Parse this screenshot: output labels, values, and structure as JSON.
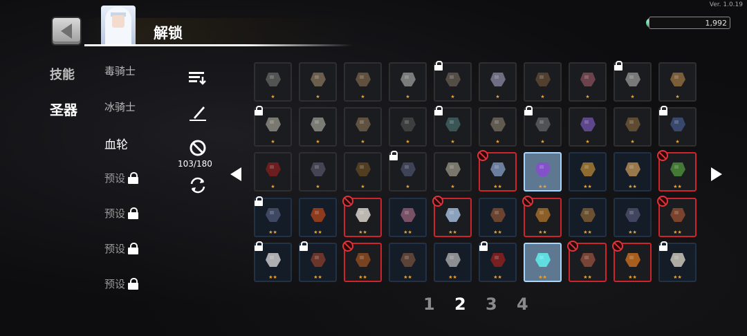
{
  "version": "Ver. 1.0.19",
  "header": {
    "title": "解锁",
    "currency": "1,992"
  },
  "categories": [
    {
      "label": "技能",
      "active": false
    },
    {
      "label": "圣器",
      "active": true
    }
  ],
  "subcategories": [
    {
      "label": "毒骑士",
      "state": "normal",
      "locked": false
    },
    {
      "label": "冰骑士",
      "state": "normal",
      "locked": false
    },
    {
      "label": "血轮",
      "state": "active",
      "locked": false
    },
    {
      "label": "预设",
      "state": "preset",
      "locked": true
    },
    {
      "label": "预设",
      "state": "preset",
      "locked": true
    },
    {
      "label": "预设",
      "state": "preset",
      "locked": true
    },
    {
      "label": "预设",
      "state": "preset",
      "locked": true
    }
  ],
  "tools": {
    "sort_icon": "sort-icon",
    "pen_icon": "pen-icon",
    "forbid_icon": "forbid-icon",
    "refresh_icon": "refresh-icon",
    "forbid_count": "103/180"
  },
  "grid": {
    "rows": [
      [
        {
          "item": "jar",
          "stars": "★",
          "badge": "",
          "style": "normal"
        },
        {
          "item": "claw",
          "stars": "★",
          "badge": "",
          "style": "normal"
        },
        {
          "item": "necklace",
          "stars": "★",
          "badge": "",
          "style": "normal"
        },
        {
          "item": "pearl",
          "stars": "★",
          "badge": "",
          "style": "normal"
        },
        {
          "item": "stone",
          "stars": "★",
          "badge": "lock",
          "style": "normal"
        },
        {
          "item": "feather-blade",
          "stars": "★",
          "badge": "",
          "style": "normal"
        },
        {
          "item": "boot",
          "stars": "★",
          "badge": "",
          "style": "normal"
        },
        {
          "item": "meat",
          "stars": "★",
          "badge": "",
          "style": "normal"
        },
        {
          "item": "spider-leg",
          "stars": "★",
          "badge": "lock",
          "style": "normal"
        },
        {
          "item": "bone-arm",
          "stars": "★",
          "badge": "",
          "style": "normal"
        }
      ],
      [
        {
          "item": "quill",
          "stars": "★",
          "badge": "lock",
          "style": "normal"
        },
        {
          "item": "fan",
          "stars": "★",
          "badge": "",
          "style": "normal"
        },
        {
          "item": "glove",
          "stars": "★",
          "badge": "",
          "style": "normal"
        },
        {
          "item": "pan",
          "stars": "★",
          "badge": "",
          "style": "normal"
        },
        {
          "item": "bowl",
          "stars": "★",
          "badge": "lock",
          "style": "normal"
        },
        {
          "item": "scroll",
          "stars": "★",
          "badge": "",
          "style": "normal"
        },
        {
          "item": "armor",
          "stars": "★",
          "badge": "lock",
          "style": "normal"
        },
        {
          "item": "magnet",
          "stars": "★",
          "badge": "",
          "style": "normal"
        },
        {
          "item": "arrow",
          "stars": "★",
          "badge": "",
          "style": "normal"
        },
        {
          "item": "shield",
          "stars": "★",
          "badge": "lock",
          "style": "normal"
        }
      ],
      [
        {
          "item": "blood-vial",
          "stars": "★",
          "badge": "",
          "style": "normal"
        },
        {
          "item": "serpent",
          "stars": "★",
          "badge": "",
          "style": "normal"
        },
        {
          "item": "pouch",
          "stars": "★",
          "badge": "",
          "style": "normal"
        },
        {
          "item": "bird",
          "stars": "★",
          "badge": "lock",
          "style": "normal"
        },
        {
          "item": "bone",
          "stars": "★",
          "badge": "",
          "style": "normal"
        },
        {
          "item": "crystal",
          "stars": "★★",
          "badge": "forbid",
          "style": "forbid"
        },
        {
          "item": "purple-feather",
          "stars": "★★",
          "badge": "",
          "style": "selected"
        },
        {
          "item": "cross",
          "stars": "★★",
          "badge": "",
          "style": "t2"
        },
        {
          "item": "shell",
          "stars": "★★",
          "badge": "",
          "style": "t2"
        },
        {
          "item": "book",
          "stars": "★★",
          "badge": "forbid",
          "style": "forbid"
        }
      ],
      [
        {
          "item": "statue",
          "stars": "★★",
          "badge": "lock",
          "style": "t2"
        },
        {
          "item": "eye",
          "stars": "★★",
          "badge": "",
          "style": "t2"
        },
        {
          "item": "dice",
          "stars": "★★",
          "badge": "forbid",
          "style": "forbid"
        },
        {
          "item": "tome",
          "stars": "★★",
          "badge": "",
          "style": "t2"
        },
        {
          "item": "ice-shard",
          "stars": "★★",
          "badge": "forbid",
          "style": "forbid"
        },
        {
          "item": "cloak",
          "stars": "★★",
          "badge": "",
          "style": "t2"
        },
        {
          "item": "coin",
          "stars": "★★",
          "badge": "forbid",
          "style": "forbid"
        },
        {
          "item": "sword",
          "stars": "★★",
          "badge": "",
          "style": "t2"
        },
        {
          "item": "dark-feather",
          "stars": "★★",
          "badge": "",
          "style": "t2"
        },
        {
          "item": "flower",
          "stars": "★★",
          "badge": "forbid",
          "style": "forbid"
        }
      ],
      [
        {
          "item": "snowflake",
          "stars": "★★",
          "badge": "lock",
          "style": "t2"
        },
        {
          "item": "jar-dark",
          "stars": "★★",
          "badge": "lock",
          "style": "t2"
        },
        {
          "item": "barrel",
          "stars": "★★",
          "badge": "forbid",
          "style": "forbid"
        },
        {
          "item": "egg",
          "stars": "★★",
          "badge": "",
          "style": "t2"
        },
        {
          "item": "skull-staff",
          "stars": "★★",
          "badge": "",
          "style": "t2"
        },
        {
          "item": "red-flag",
          "stars": "★★",
          "badge": "lock",
          "style": "t2"
        },
        {
          "item": "cyan-gem",
          "stars": "★★",
          "badge": "",
          "style": "selected"
        },
        {
          "item": "steak",
          "stars": "★★",
          "badge": "forbid",
          "style": "forbid"
        },
        {
          "item": "torch",
          "stars": "★★",
          "badge": "forbid",
          "style": "forbid"
        },
        {
          "item": "cloth",
          "stars": "★★",
          "badge": "lock",
          "style": "t2"
        }
      ]
    ]
  },
  "pagination": {
    "pages": [
      "1",
      "2",
      "3",
      "4"
    ],
    "active_index": 1
  },
  "colors": {
    "forbid_border": "#d0232b",
    "selected_bg": "#5f7892",
    "star": "#e9a533"
  }
}
